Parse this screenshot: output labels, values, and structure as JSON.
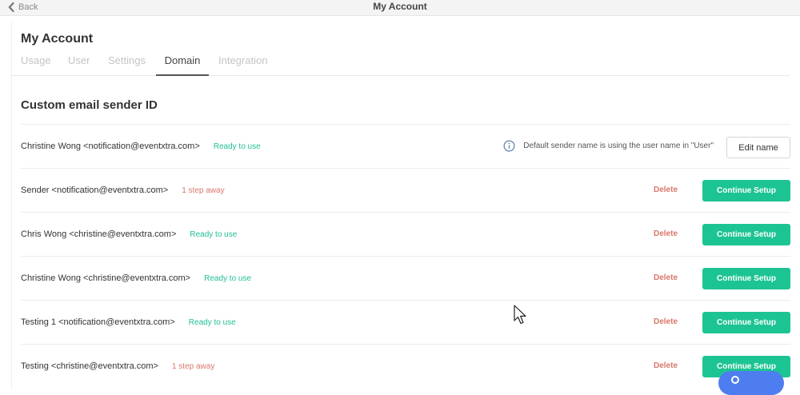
{
  "topbar": {
    "back_label": "Back",
    "title": "My Account"
  },
  "page": {
    "title": "My Account",
    "tabs": [
      {
        "label": "Usage",
        "active": false
      },
      {
        "label": "User",
        "active": false
      },
      {
        "label": "Settings",
        "active": false
      },
      {
        "label": "Domain",
        "active": true
      },
      {
        "label": "Integration",
        "active": false
      }
    ]
  },
  "section": {
    "title": "Custom email sender ID"
  },
  "rows": [
    {
      "sender": "Christine Wong <notification@eventxtra.com>",
      "status": "Ready to use",
      "info": "Default sender name is using the user name in \"User\"",
      "action": "Edit name"
    },
    {
      "sender": "Sender <notification@eventxtra.com>",
      "status": "1 step away",
      "delete": "Delete",
      "action": "Continue Setup"
    },
    {
      "sender": "Chris Wong <christine@eventxtra.com>",
      "status": "Ready to use",
      "delete": "Delete",
      "action": "Continue Setup"
    },
    {
      "sender": "Christine Wong <christine@eventxtra.com>",
      "status": "Ready to use",
      "delete": "Delete",
      "action": "Continue Setup"
    },
    {
      "sender": "Testing 1 <notification@eventxtra.com>",
      "status": "Ready to use",
      "delete": "Delete",
      "action": "Continue Setup"
    },
    {
      "sender": "Testing <christine@eventxtra.com>",
      "status": "1 step away",
      "delete": "Delete",
      "action": "Continue Setup"
    }
  ],
  "icons": {
    "back": "chevron-left-icon",
    "info": "info-circle-icon",
    "cursor": "mouse-pointer-icon",
    "chat": "chat-bubble-icon"
  },
  "colors": {
    "accent": "#1dc493",
    "ready": "#1fbf95",
    "warning": "#d9776a",
    "chat": "#4e7df0"
  }
}
